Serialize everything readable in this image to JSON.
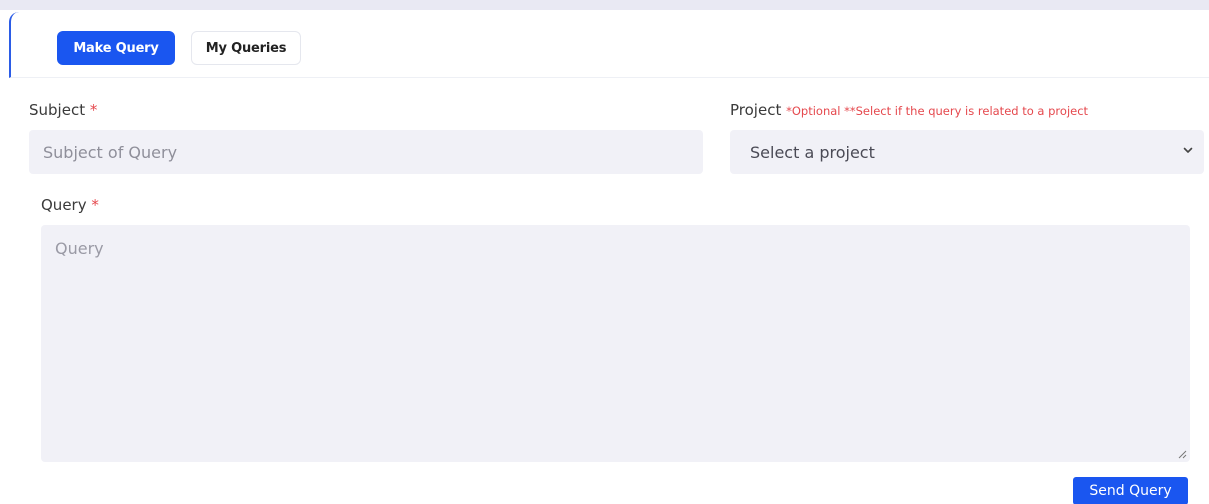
{
  "tabs": {
    "make_query": "Make Query",
    "my_queries": "My Queries",
    "active": "Make Query"
  },
  "form": {
    "subject": {
      "label": "Subject",
      "required_mark": "*",
      "placeholder": "Subject of Query",
      "value": ""
    },
    "project": {
      "label": "Project",
      "note": "*Optional **Select if the query is related to a project",
      "selected": "Select a project",
      "icon": "chevron-down-icon"
    },
    "query": {
      "label": "Query",
      "required_mark": "*",
      "placeholder": "Query",
      "value": ""
    },
    "submit_label": "Send Query"
  },
  "colors": {
    "accent": "#1a56f0",
    "required": "#e5484d",
    "field_bg": "#f1f1f7"
  }
}
